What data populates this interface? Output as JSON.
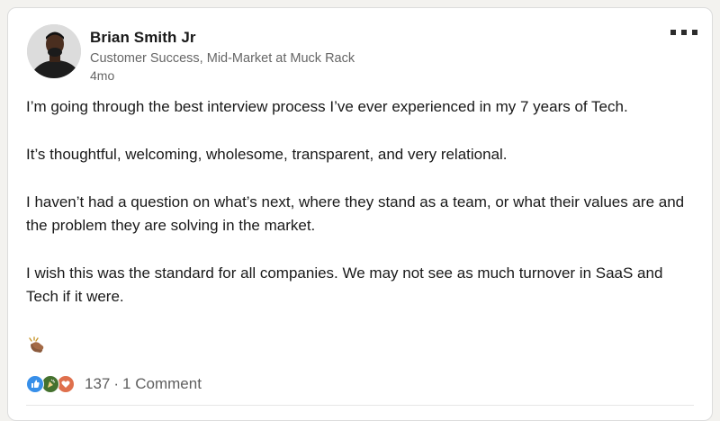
{
  "post": {
    "author": {
      "name": "Brian Smith Jr",
      "headline": "Customer Success, Mid-Market at Muck Rack",
      "time": "4mo"
    },
    "paragraphs": [
      "I’m going through the best interview process I’ve ever experienced in my 7 years of Tech.",
      "It’s thoughtful, welcoming, wholesome, transparent, and very relational.",
      "I haven’t had a question on what’s next, where they stand as a team, or what their values are and the problem they are solving in the market.",
      "I wish this was the standard for all companies. We may not see as much turnover in SaaS and Tech if it were."
    ],
    "emoji_icon": "clapping-hands-icon",
    "social": {
      "reaction_icons": [
        "like-icon",
        "celebrate-icon",
        "love-icon"
      ],
      "reaction_count": "137",
      "separator": "·",
      "comments": "1 Comment"
    }
  },
  "colors": {
    "like": "#378fe9",
    "celebrate": "#44712e",
    "love": "#df704d",
    "text": "#191919",
    "muted": "#666666"
  }
}
